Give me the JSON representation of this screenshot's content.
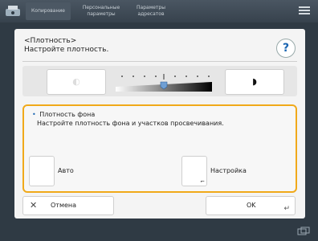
{
  "topbar": {
    "tabs": [
      {
        "label": "Копирование"
      },
      {
        "line1": "Персональные",
        "line2": "параметры"
      },
      {
        "line1": "Параметры",
        "line2": "адресатов"
      }
    ]
  },
  "dialog": {
    "title_line1": "<Плотность>",
    "title_line2": "Настройте плотность.",
    "help_label": "?",
    "density": {
      "light_glyph": "◐",
      "dark_glyph": "◗",
      "level_fraction": 0.5
    },
    "background_density": {
      "bullet": "•",
      "title": "Плотность фона",
      "description": "Настройте плотность фона и участков просвечивания.",
      "auto_label": "Авто",
      "setup_label": "Настройка",
      "setup_corner": "⌐"
    },
    "footer": {
      "cancel_icon": "✕",
      "cancel_label": "Отмена",
      "ok_label": "OK",
      "ok_corner": "↵"
    }
  },
  "colors": {
    "accent_orange": "#f0a91a",
    "help_blue": "#1b66b2",
    "frame": "#2f3a44"
  },
  "icons": [
    "copier-logo-icon",
    "menu-icon",
    "help-icon",
    "status-icon"
  ]
}
